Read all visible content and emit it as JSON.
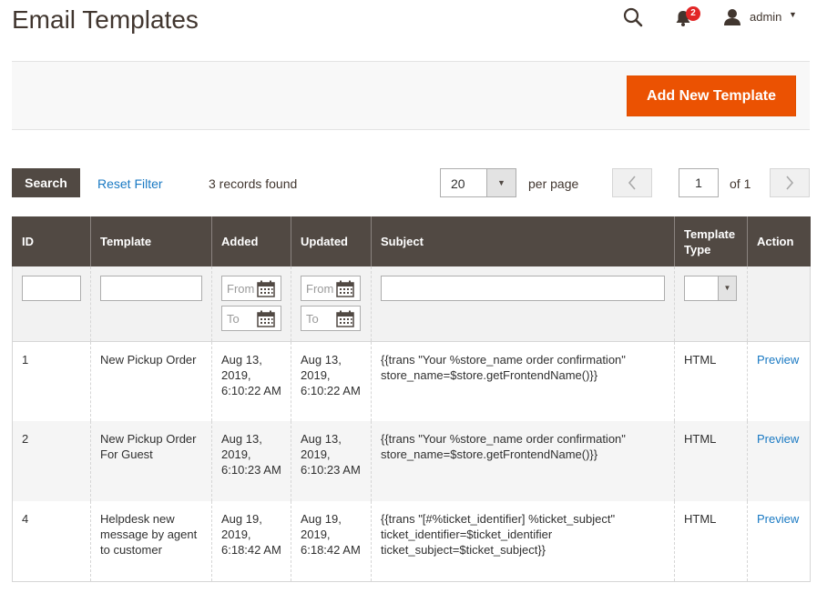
{
  "page": {
    "title": "Email Templates"
  },
  "header": {
    "notifications_count": "2",
    "user_name": "admin",
    "icons": [
      "search-icon",
      "bell-icon",
      "user-icon",
      "caret-down-icon"
    ]
  },
  "actions": {
    "add_new_label": "Add New Template"
  },
  "toolbar": {
    "search_label": "Search",
    "reset_label": "Reset Filter",
    "records_found": "3 records found",
    "per_page_value": "20",
    "per_page_label": "per page",
    "current_page": "1",
    "of_pages": "of 1"
  },
  "filters": {
    "from_placeholder": "From",
    "to_placeholder": "To"
  },
  "grid": {
    "columns": [
      "ID",
      "Template",
      "Added",
      "Updated",
      "Subject",
      "Template Type",
      "Action"
    ],
    "rows": [
      {
        "id": "1",
        "template": "New Pickup Order",
        "added": "Aug 13, 2019, 6:10:22 AM",
        "updated": "Aug 13, 2019, 6:10:22 AM",
        "subject": "{{trans \"Your %store_name order confirmation\" store_name=$store.getFrontendName()}}",
        "type": "HTML",
        "action": "Preview"
      },
      {
        "id": "2",
        "template": "New Pickup Order For Guest",
        "added": "Aug 13, 2019, 6:10:23 AM",
        "updated": "Aug 13, 2019, 6:10:23 AM",
        "subject": "{{trans \"Your %store_name order confirmation\" store_name=$store.getFrontendName()}}",
        "type": "HTML",
        "action": "Preview"
      },
      {
        "id": "4",
        "template": "Helpdesk new message by agent to customer",
        "added": "Aug 19, 2019, 6:18:42 AM",
        "updated": "Aug 19, 2019, 6:18:42 AM",
        "subject": "{{trans \"[#%ticket_identifier] %ticket_subject\" ticket_identifier=$ticket_identifier ticket_subject=$ticket_subject}}",
        "type": "HTML",
        "action": "Preview"
      }
    ]
  },
  "colors": {
    "accent": "#eb5202",
    "header_bg": "#514943",
    "link": "#1979c3",
    "badge": "#e22626"
  }
}
